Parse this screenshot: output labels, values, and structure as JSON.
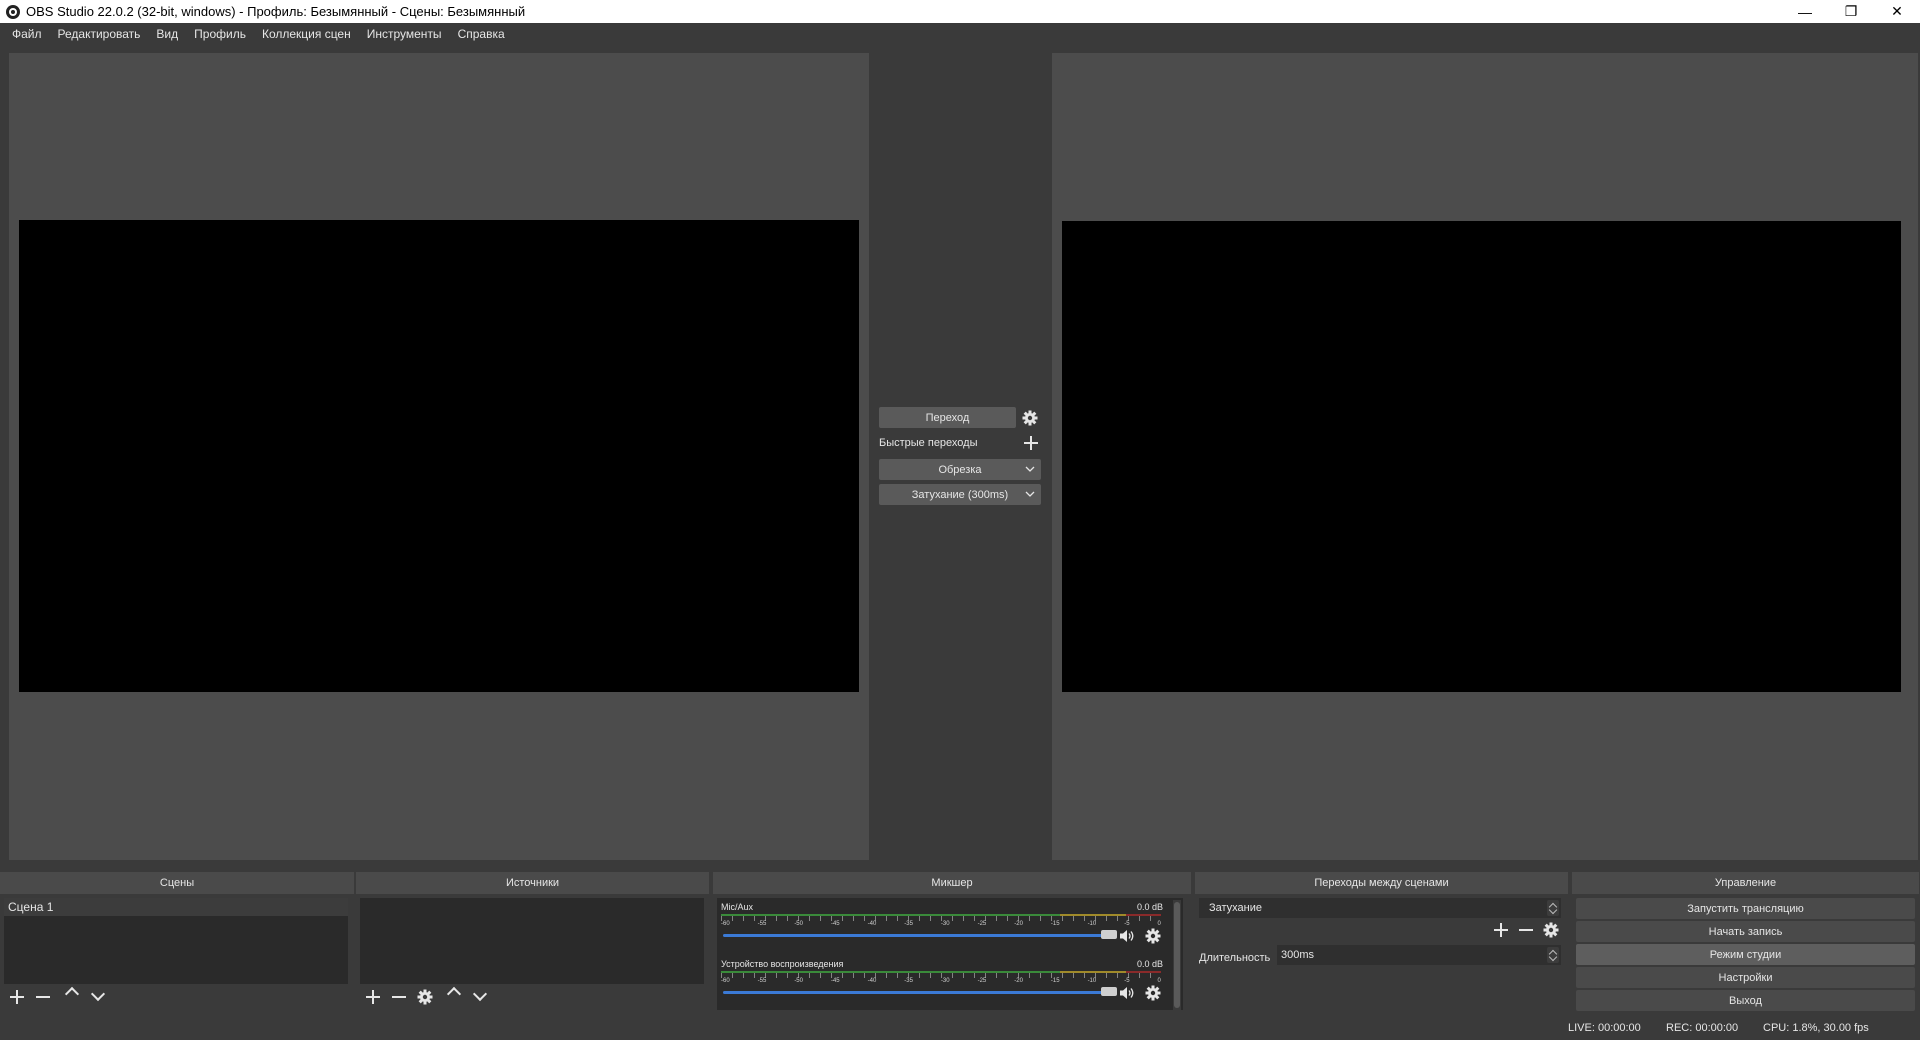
{
  "window": {
    "title": "OBS Studio 22.0.2 (32-bit, windows) - Профиль: Безымянный - Сцены: Безымянный",
    "minimize": "—",
    "maximize": "❐",
    "close": "✕"
  },
  "menu": [
    "Файл",
    "Редактировать",
    "Вид",
    "Профиль",
    "Коллекция сцен",
    "Инструменты",
    "Справка"
  ],
  "center": {
    "transition_button": "Переход",
    "quick_transitions_label": "Быстрые переходы",
    "quick_transitions": [
      "Обрезка",
      "Затухание (300ms)"
    ]
  },
  "docks": {
    "scenes": {
      "title": "Сцены",
      "items": [
        "Сцена 1"
      ]
    },
    "sources": {
      "title": "Источники"
    },
    "mixer": {
      "title": "Микшер",
      "channels": [
        {
          "name": "Mic/Aux",
          "db": "0.0 dB",
          "volume": 1.0
        },
        {
          "name": "Устройство воспроизведения",
          "db": "0.0 dB",
          "volume": 1.0
        }
      ],
      "tick_labels": [
        "-60",
        "-55",
        "-50",
        "-45",
        "-40",
        "-35",
        "-30",
        "-25",
        "-20",
        "-15",
        "-10",
        "-5",
        "0"
      ]
    },
    "transitions": {
      "title": "Переходы между сценами",
      "selected": "Затухание",
      "duration_label": "Длительность",
      "duration_value": "300ms"
    },
    "controls": {
      "title": "Управление",
      "buttons": [
        "Запустить трансляцию",
        "Начать запись",
        "Режим студии",
        "Настройки",
        "Выход"
      ]
    }
  },
  "status": {
    "live": "LIVE: 00:00:00",
    "rec": "REC: 00:00:00",
    "cpu": "CPU: 1.8%, 30.00 fps"
  },
  "colors": {
    "background": "#3a3a3a",
    "panel": "#4c4c4c",
    "canvas": "#000000",
    "accent_slider": "#3b7ad6"
  },
  "icons": {
    "gear": "gear-icon",
    "plus": "plus-icon",
    "minus": "minus-icon",
    "arrow_up": "arrow-up-icon",
    "arrow_down": "arrow-down-icon",
    "speaker": "speaker-icon",
    "chevron": "chevron-down-icon"
  }
}
